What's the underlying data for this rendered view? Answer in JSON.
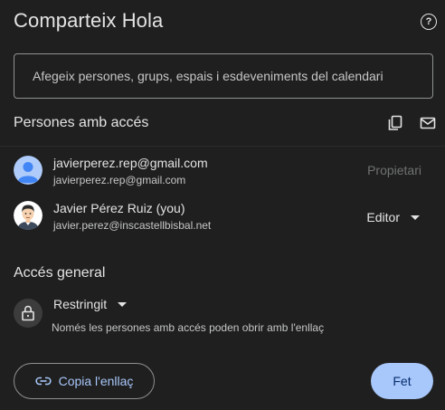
{
  "dialog": {
    "title": "Comparteix Hola",
    "help_icon": "help-circle-icon",
    "add_people_placeholder": "Afegeix persones, grups, espais i esdeveniments del calendari"
  },
  "people_section": {
    "title": "Persones amb accés",
    "copy_emails_icon": "copy-icon",
    "email_collaborators_icon": "mail-icon",
    "people": [
      {
        "name": "javierperez.rep@gmail.com",
        "email": "javierperez.rep@gmail.com",
        "role": "Propietari",
        "avatar_icon": "default-avatar-icon"
      },
      {
        "name": "Javier Pérez Ruiz (you)",
        "email": "javier.perez@inscastellbisbal.net",
        "role": "Editor",
        "avatar_icon": "cartoon-avatar-icon"
      }
    ]
  },
  "general_access": {
    "title": "Accés general",
    "lock_icon": "lock-icon",
    "level": "Restringit",
    "description": "Només les persones amb accés poden obrir amb l'enllaç"
  },
  "footer": {
    "copy_link_label": "Copia l'enllaç",
    "link_icon": "link-icon",
    "done_label": "Fet"
  },
  "colors": {
    "background": "#1f1f1f",
    "accent": "#a8c7fa",
    "text_primary": "#e3e3e3",
    "text_secondary": "#c4c7c5",
    "text_disabled": "#6f7173"
  }
}
